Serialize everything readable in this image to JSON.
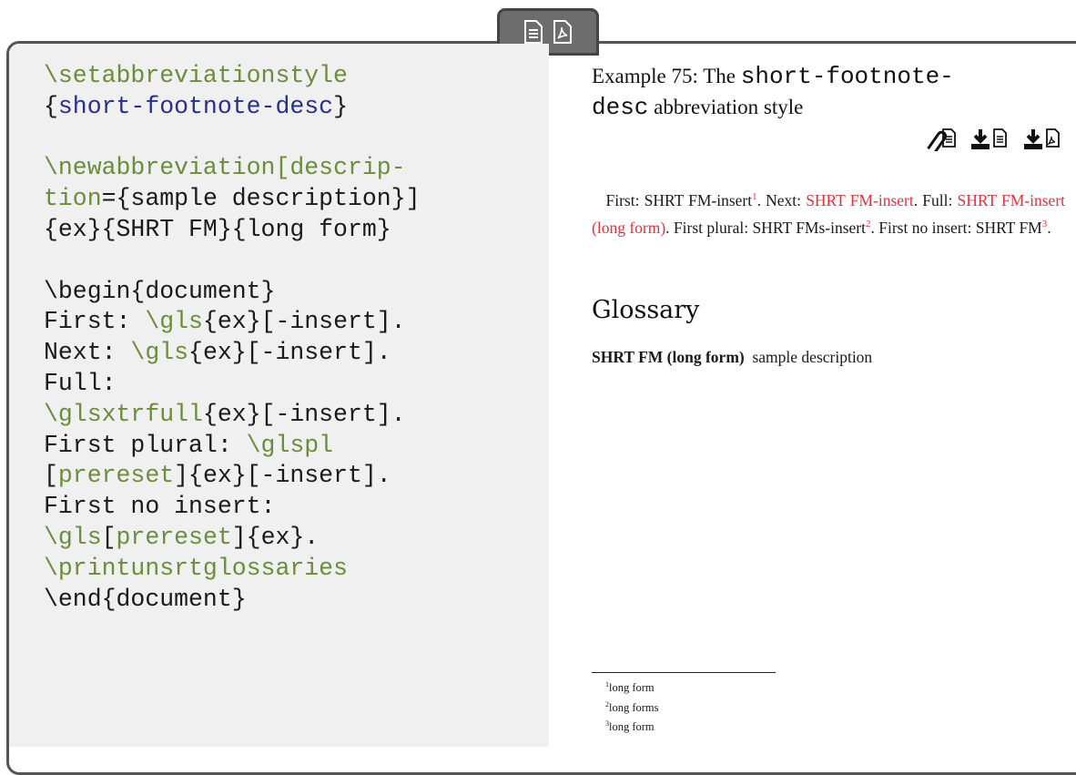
{
  "code": {
    "l1": "\\setabbreviationstyle",
    "l2a": "{",
    "l2b": "short-footnote-desc",
    "l2c": "}",
    "l3": "\\newabbreviation",
    "l3b": "[descrip-",
    "l4a": "tion",
    "l4b": "={sample description}]",
    "l5": "{ex}{SHRT FM}{long form}",
    "l6": "\\begin{document}",
    "l7a": "First: ",
    "l7b": "\\gls",
    "l7c": "{ex}[-insert].",
    "l8a": "Next: ",
    "l8b": "\\gls",
    "l8c": "{ex}[-insert].",
    "l9": "Full:",
    "l10a": "\\glsxtrfull",
    "l10b": "{ex}[-insert].",
    "l11a": "First plural: ",
    "l11b": "\\glspl",
    "l12a": "[",
    "l12b": "prereset",
    "l12c": "]{ex}[-insert].",
    "l13": "First no insert:",
    "l14a": "\\gls",
    "l14b": "[",
    "l14c": "prereset",
    "l14d": "]{ex}.",
    "l15": "\\printunsrtglossaries",
    "l16": "\\end{document}"
  },
  "example": {
    "title_a": "Example 75: The ",
    "title_mono1": "short-footnote-",
    "title_mono2": "desc",
    "title_b": " abbreviation style"
  },
  "output": {
    "p1": "First: SHRT FM-insert",
    "fn1": "1",
    "p2": ". Next: ",
    "r1": "SHRT FM-insert",
    "p3": ". Full: ",
    "r2": "SHRT FM-insert (long form)",
    "p4": ". First plural: SHRT FMs-insert",
    "fn2": "2",
    "p5": ". First no insert: SHRT FM",
    "fn3": "3",
    "p6": "."
  },
  "glossary": {
    "heading": "Glossary",
    "term": "SHRT FM (long form)",
    "desc": "sample description"
  },
  "footnotes": [
    {
      "num": "1",
      "text": "long form"
    },
    {
      "num": "2",
      "text": "long forms"
    },
    {
      "num": "3",
      "text": "long form"
    }
  ],
  "icons": [
    "document-icon",
    "pdf-icon",
    "attachment-icon",
    "download-document-icon",
    "download-pdf-icon"
  ]
}
